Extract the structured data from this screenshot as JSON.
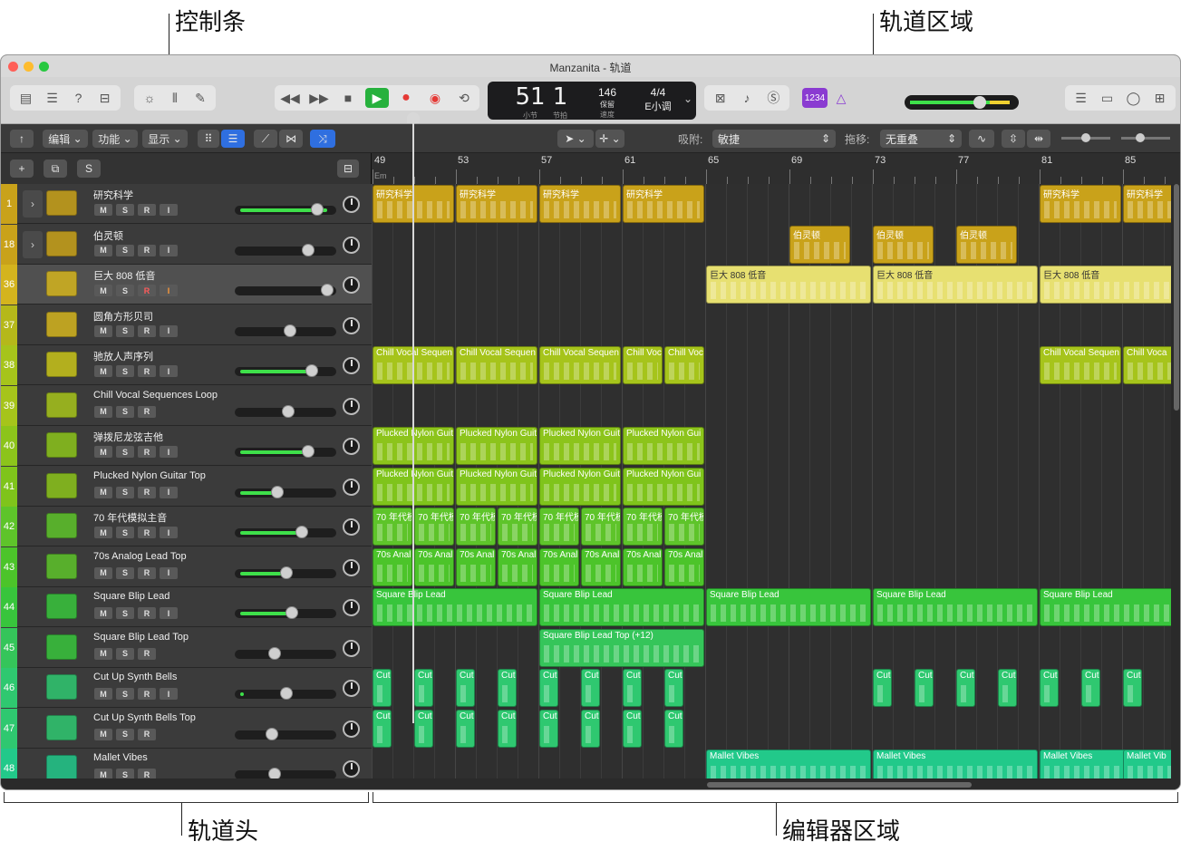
{
  "callouts": {
    "control_bar": "控制条",
    "tracks_area": "轨道区域",
    "track_headers": "轨道头",
    "editor_area": "编辑器区域"
  },
  "window": {
    "title": "Manzanita - 轨道"
  },
  "lcd": {
    "bar": "51",
    "beat": "1",
    "bar_label": "小节",
    "beat_label": "节拍",
    "tempo": "146",
    "tempo_mode": "保留",
    "tempo_label": "速度",
    "signature": "4/4",
    "key": "E小调"
  },
  "count_in_badge": "1234",
  "toolbar": {
    "edit": "编辑",
    "functions": "功能",
    "view": "显示",
    "snap_label": "吸附:",
    "snap_value": "敏捷",
    "drag_label": "拖移:",
    "drag_value": "无重叠"
  },
  "track_header_buttons": {
    "add": "+",
    "solo": "S"
  },
  "buttons": {
    "mute": "M",
    "solo": "S",
    "record": "R",
    "input": "I"
  },
  "ruler": {
    "bars": [
      "49",
      "53",
      "57",
      "61",
      "65",
      "69",
      "73",
      "77",
      "81",
      "85"
    ],
    "chord": "Em"
  },
  "tracks": [
    {
      "num": "1",
      "name": "研究科学"
    },
    {
      "num": "18",
      "name": "伯灵顿"
    },
    {
      "num": "36",
      "name": "巨大 808 低音"
    },
    {
      "num": "37",
      "name": "圆角方形贝司"
    },
    {
      "num": "38",
      "name": "驰放人声序列"
    },
    {
      "num": "39",
      "name": "Chill Vocal Sequences Loop"
    },
    {
      "num": "40",
      "name": "弹拨尼龙弦吉他"
    },
    {
      "num": "41",
      "name": "Plucked Nylon Guitar Top"
    },
    {
      "num": "42",
      "name": "70 年代模拟主音"
    },
    {
      "num": "43",
      "name": "70s Analog Lead Top"
    },
    {
      "num": "44",
      "name": "Square Blip Lead"
    },
    {
      "num": "45",
      "name": "Square Blip Lead Top"
    },
    {
      "num": "46",
      "name": "Cut Up Synth Bells"
    },
    {
      "num": "47",
      "name": "Cut Up Synth Bells Top"
    },
    {
      "num": "48",
      "name": "Mallet Vibes"
    }
  ],
  "region_labels": {
    "r0": "研究科学",
    "r1": "伯灵顿",
    "r2": "巨大 808 低音",
    "r4": "Chill Vocal Sequen",
    "r4s": "Chill Voc",
    "r4t": "Chill Voca",
    "r6": "Plucked Nylon Guit",
    "r6s": "Plucked Nylon Gui",
    "r8": "70 年代模",
    "r9": "70s Anal",
    "r10": "Square Blip Lead",
    "r11": "Square Blip Lead Top (+12)",
    "r12": "Cut",
    "r14": "Mallet Vibes",
    "r14s": "Mallet Vib"
  },
  "colors": {
    "yellow_dark": "#c9a21a",
    "yellow_light": "#e7e071",
    "lime": "#a6c41b",
    "green": "#38c53c",
    "green2": "#2fc870",
    "mint": "#22c98a"
  }
}
